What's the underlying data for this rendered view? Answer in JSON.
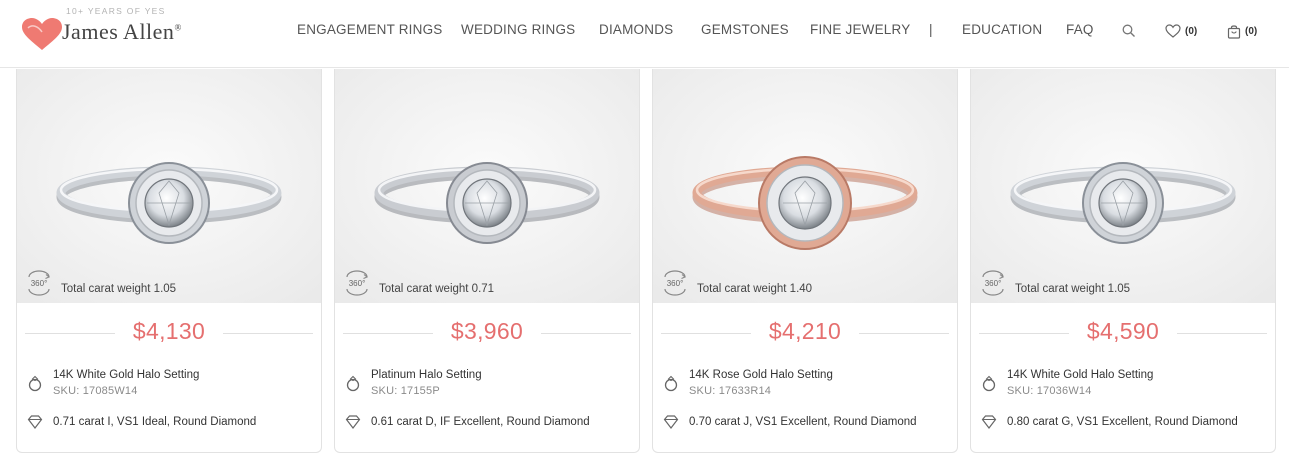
{
  "header": {
    "tagline": "10+ YEARS OF YES",
    "brand": "James Allen",
    "registered": "®",
    "nav": [
      {
        "label": "ENGAGEMENT RINGS"
      },
      {
        "label": "WEDDING RINGS"
      },
      {
        "label": "DIAMONDS"
      },
      {
        "label": "GEMSTONES"
      },
      {
        "label": "FINE JEWELRY"
      },
      {
        "label": "EDUCATION"
      },
      {
        "label": "FAQ"
      }
    ],
    "separator": "|",
    "wishlist_count": "(0)",
    "cart_count": "(0)"
  },
  "colors": {
    "accent": "#e56f6f",
    "heart": "#ef7a72"
  },
  "products": [
    {
      "carat_weight": "Total carat weight 1.05",
      "price": "$4,130",
      "setting": "14K White Gold Halo Setting",
      "sku": "SKU: 17085W14",
      "diamond": "0.71 carat I, VS1 Ideal, Round Diamond",
      "metal": "white"
    },
    {
      "carat_weight": "Total carat weight 0.71",
      "price": "$3,960",
      "setting": "Platinum Halo Setting",
      "sku": "SKU: 17155P",
      "diamond": "0.61 carat D, IF Excellent, Round Diamond",
      "metal": "platinum"
    },
    {
      "carat_weight": "Total carat weight 1.40",
      "price": "$4,210",
      "setting": "14K Rose Gold Halo Setting",
      "sku": "SKU: 17633R14",
      "diamond": "0.70 carat J, VS1 Excellent, Round Diamond",
      "metal": "rose"
    },
    {
      "carat_weight": "Total carat weight 1.05",
      "price": "$4,590",
      "setting": "14K White Gold Halo Setting",
      "sku": "SKU: 17036W14",
      "diamond": "0.80 carat G, VS1 Excellent, Round Diamond",
      "metal": "white"
    }
  ],
  "icons": [
    "heart-logo-icon",
    "search-icon",
    "heart-icon",
    "shopping-bag-icon",
    "rotate-360-icon",
    "ring-icon",
    "diamond-icon"
  ]
}
